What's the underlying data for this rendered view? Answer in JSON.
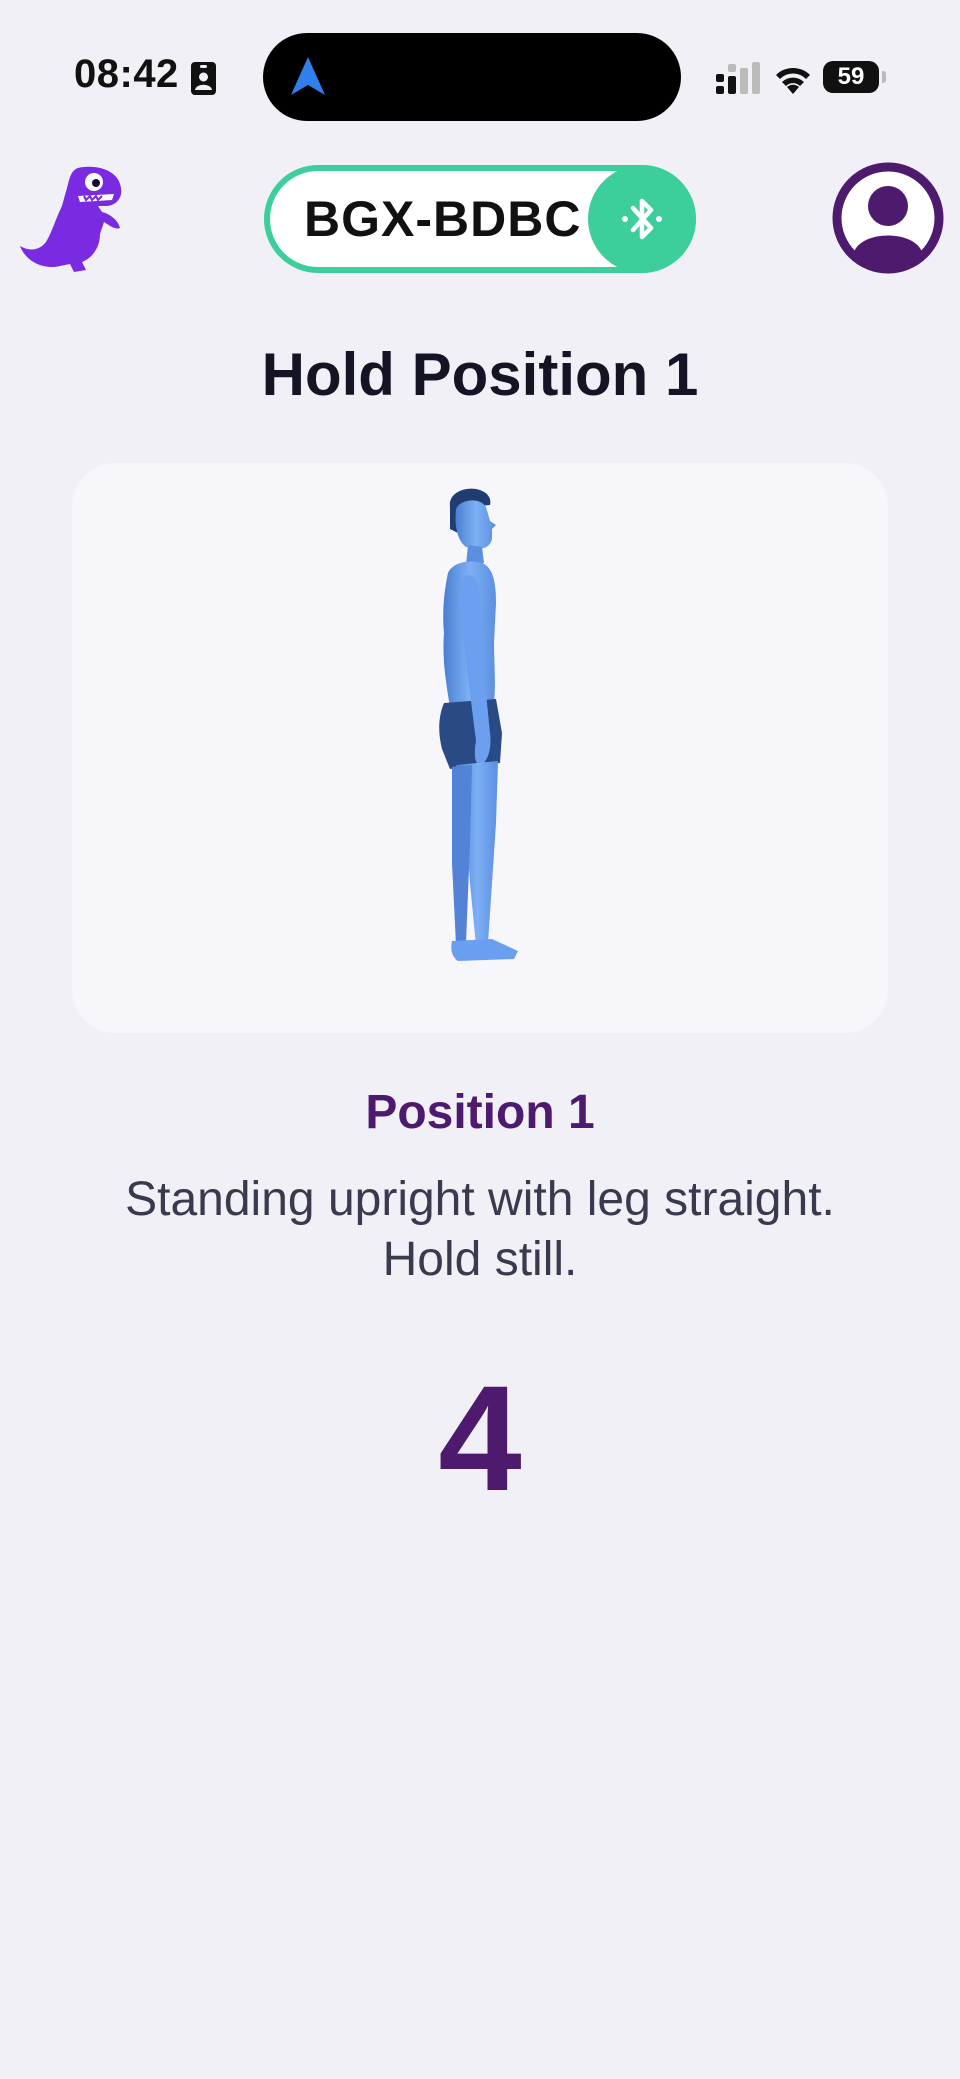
{
  "status_bar": {
    "time": "08:42",
    "battery": "59",
    "icons": [
      "contact-card-icon",
      "navigation-arrow-icon",
      "cell-signal-icon",
      "wifi-icon",
      "battery-icon"
    ]
  },
  "header": {
    "logo_icon": "dinosaur-logo-icon",
    "device_name": "BGX-BDBC",
    "bluetooth_icon": "bluetooth-icon",
    "profile_icon": "user-profile-icon"
  },
  "main": {
    "title": "Hold Position 1",
    "position_name": "Position 1",
    "instruction_line1": "Standing upright with leg straight.",
    "instruction_line2": "Hold still.",
    "countdown": "4"
  },
  "colors": {
    "accent_green": "#3dcf9b",
    "brand_purple": "#4e1a6e",
    "logo_purple": "#7a2be2",
    "figure_blue": "#6a9ff0",
    "background": "#f0f0f6"
  }
}
